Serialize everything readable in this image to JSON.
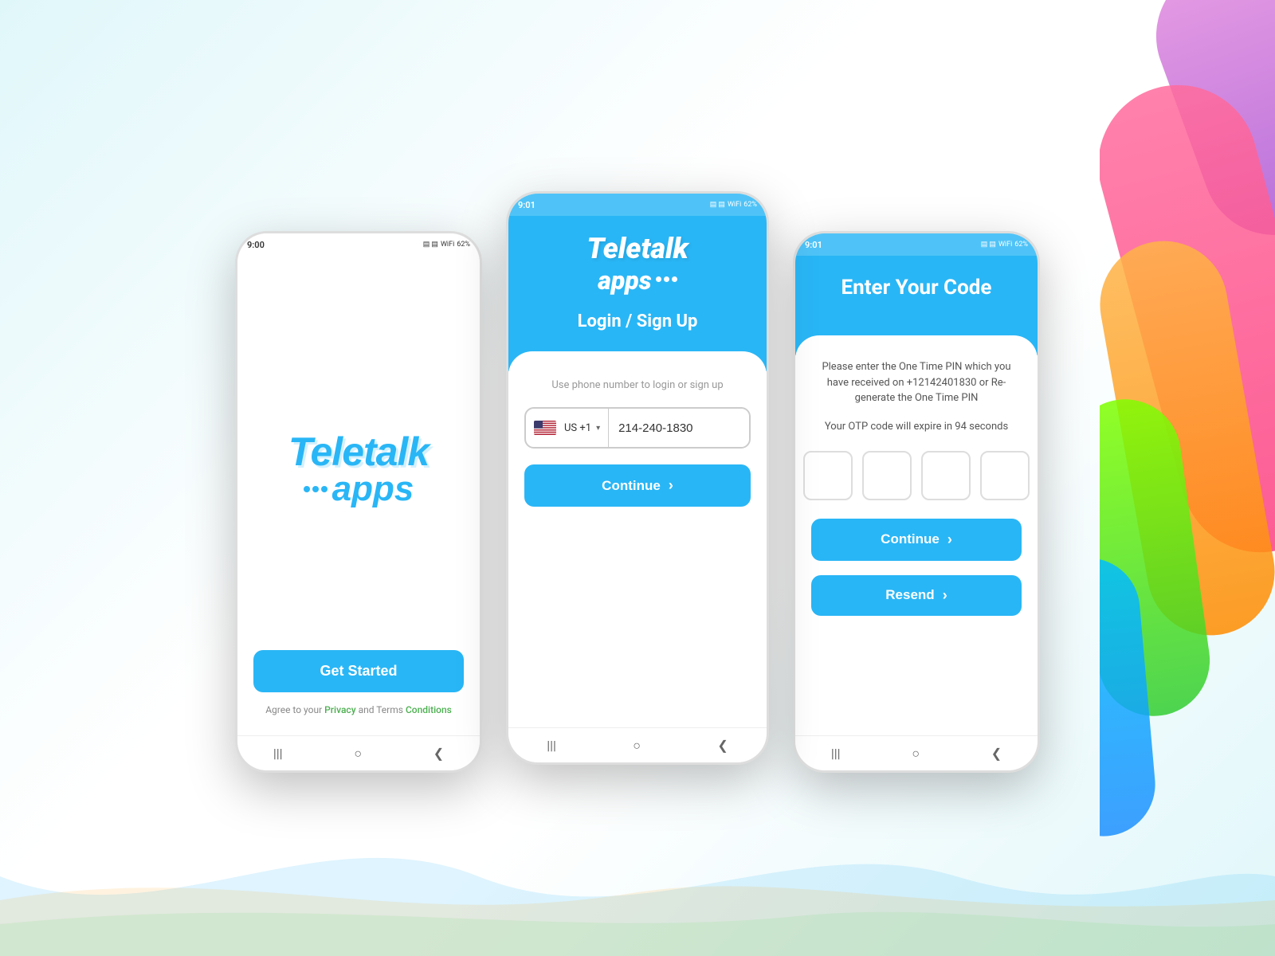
{
  "background": {
    "color": "#e8f7ff"
  },
  "phone1": {
    "status_time": "9:00",
    "logo_line1": "Teletalk",
    "logo_line2": "apps",
    "get_started_label": "Get Started",
    "terms_prefix": "Agree to your",
    "terms_privacy": "Privacy",
    "terms_middle": "and Terms",
    "terms_conditions": "Conditions"
  },
  "phone2": {
    "status_time": "9:01",
    "logo_line1": "Teletalk",
    "logo_line2": "apps",
    "login_title": "Login / Sign Up",
    "phone_hint": "Use phone number to login or sign up",
    "country_code": "US  +1",
    "phone_number": "214-240-1830",
    "continue_label": "Continue"
  },
  "phone3": {
    "status_time": "9:01",
    "header_title": "Enter Your Code",
    "description": "Please enter the One Time PIN which you have received on +12142401830 or Re-generate the One Time PIN",
    "timer_text": "Your OTP code will expire in 94 seconds",
    "continue_label": "Continue",
    "resend_label": "Resend"
  },
  "nav": {
    "back_icon": "❮",
    "home_icon": "○",
    "menu_icon": "|||"
  }
}
